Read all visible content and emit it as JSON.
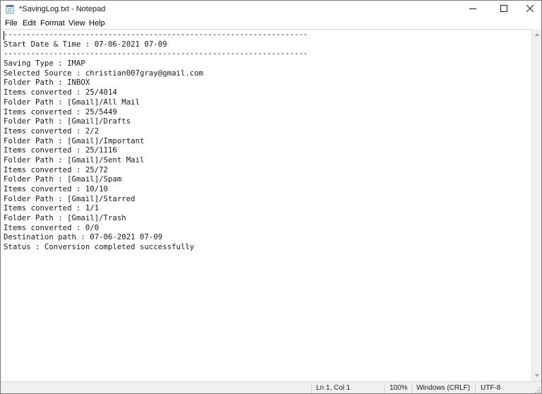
{
  "window": {
    "title": "*SavingLog.txt - Notepad",
    "icons": {
      "app": "notepad-icon",
      "minimize": "minimize-icon",
      "maximize": "maximize-icon",
      "close": "close-icon"
    }
  },
  "menu": {
    "items": [
      "File",
      "Edit",
      "Format",
      "View",
      "Help"
    ]
  },
  "editor": {
    "lines": [
      "-------------------------------------------------------------------",
      "Start Date & Time : 07-06-2021 07-09",
      "-------------------------------------------------------------------",
      "Saving Type : IMAP",
      "Selected Source : christian007gray@gmail.com",
      "Folder Path : INBOX",
      "Items converted : 25/4014",
      "Folder Path : [Gmail]/All Mail",
      "Items converted : 25/5449",
      "Folder Path : [Gmail]/Drafts",
      "Items converted : 2/2",
      "Folder Path : [Gmail]/Important",
      "Items converted : 25/1116",
      "Folder Path : [Gmail]/Sent Mail",
      "Items converted : 25/72",
      "Folder Path : [Gmail]/Spam",
      "Items converted : 10/10",
      "Folder Path : [Gmail]/Starred",
      "Items converted : 1/1",
      "Folder Path : [Gmail]/Trash",
      "Items converted : 0/0",
      "Destination path : 07-06-2021 07-09",
      "Status : Conversion completed successfully"
    ]
  },
  "statusbar": {
    "position": "Ln 1, Col 1",
    "zoom": "100%",
    "line_ending": "Windows (CRLF)",
    "encoding": "UTF-8"
  }
}
